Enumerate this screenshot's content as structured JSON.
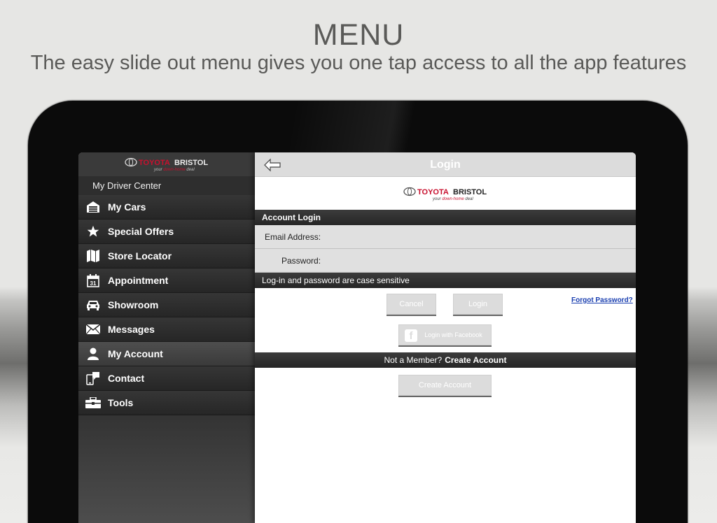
{
  "promo": {
    "headline": "MENU",
    "subline": "The easy slide out menu gives you one tap access to all the app features"
  },
  "brand": {
    "name_red": "TOYOTA",
    "name_dark": "BRISTOL",
    "tagline_pre": "your ",
    "tagline_red": "down-home",
    "tagline_post": " deal",
    "red": "#c8102e"
  },
  "sidebar": {
    "section_label": "My Driver Center",
    "items": [
      {
        "label": "My Cars",
        "icon": "garage-icon"
      },
      {
        "label": "Special Offers",
        "icon": "star-icon"
      },
      {
        "label": "Store Locator",
        "icon": "map-icon"
      },
      {
        "label": "Appointment",
        "icon": "calendar-icon",
        "icon_text": "31"
      },
      {
        "label": "Showroom",
        "icon": "car-icon"
      },
      {
        "label": "Messages",
        "icon": "envelope-icon"
      },
      {
        "label": "My Account",
        "icon": "person-icon",
        "active": true
      },
      {
        "label": "Contact",
        "icon": "phone-icon"
      },
      {
        "label": "Tools",
        "icon": "toolbox-icon"
      }
    ]
  },
  "main": {
    "title": "Login",
    "account_login_label": "Account Login",
    "email_label": "Email Address:",
    "email_value": "",
    "password_label": "Password:",
    "password_value": "",
    "case_note": "Log-in and password are case sensitive",
    "cancel_label": "Cancel",
    "login_label": "Login",
    "forgot_label": "Forgot Password?",
    "facebook_label": "Login with Facebook",
    "not_member_label": "Not a Member?",
    "create_account_link": "Create Account",
    "create_account_button": "Create Account"
  }
}
